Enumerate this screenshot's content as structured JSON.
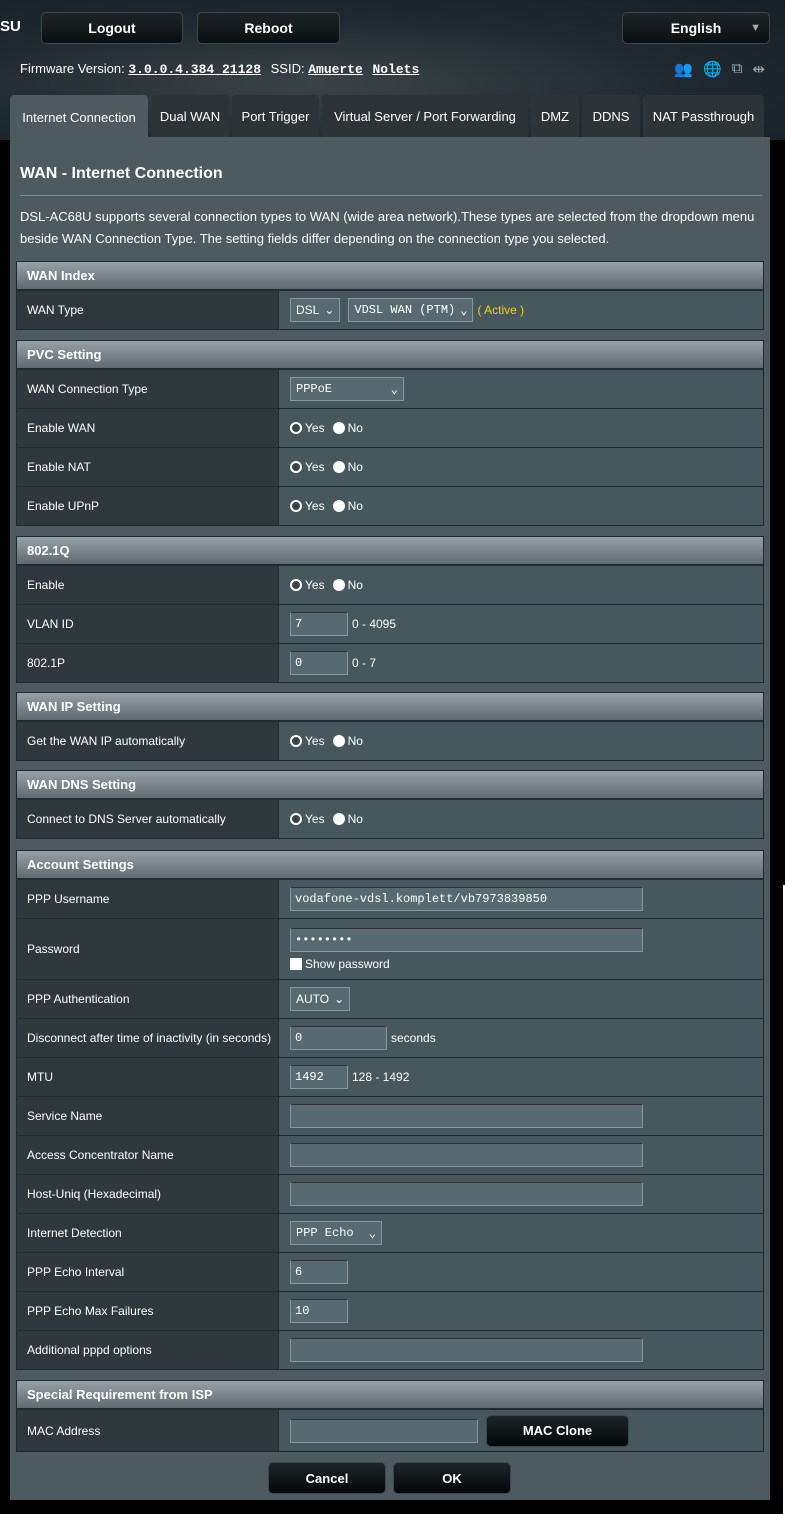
{
  "header": {
    "brand": "SU",
    "logout": "Logout",
    "reboot": "Reboot",
    "language": "English",
    "firmware_label": "Firmware Version:",
    "firmware": "3.0.0.4.384_21128",
    "ssid_label": "SSID:",
    "ssid1": "Amuerte",
    "ssid2": "Nolets"
  },
  "tabs": [
    "Internet Connection",
    "Dual WAN",
    "Port Trigger",
    "Virtual Server / Port Forwarding",
    "DMZ",
    "DDNS",
    "NAT Passthrough"
  ],
  "page": {
    "title": "WAN - Internet Connection",
    "description": "DSL-AC68U supports several connection types to WAN (wide area network).These types are selected from the dropdown menu beside WAN Connection Type. The setting fields differ depending on the connection type you selected."
  },
  "common": {
    "yes": "Yes",
    "no": "No"
  },
  "wan_index": {
    "title": "WAN Index",
    "wan_type_label": "WAN Type",
    "wan_type": "DSL",
    "wan_mode": "VDSL WAN (PTM)",
    "active": "( Active )"
  },
  "pvc": {
    "title": "PVC Setting",
    "conn_type_label": "WAN Connection Type",
    "conn_type": "PPPoE",
    "enable_wan": "Enable WAN",
    "enable_nat": "Enable NAT",
    "enable_upnp": "Enable UPnP"
  },
  "dot1q": {
    "title": "802.1Q",
    "enable": "Enable",
    "vlan_label": "VLAN ID",
    "vlan": "7",
    "vlan_range": "0 - 4095",
    "p_label": "802.1P",
    "p": "0",
    "p_range": "0 - 7"
  },
  "wanip": {
    "title": "WAN IP Setting",
    "auto": "Get the WAN IP automatically"
  },
  "wandns": {
    "title": "WAN DNS Setting",
    "auto": "Connect to DNS Server automatically"
  },
  "account": {
    "title": "Account Settings",
    "user_label": "PPP Username",
    "user": "vodafone-vdsl.komplett/vb7973839850",
    "pass_label": "Password",
    "pass": "••••••••",
    "show_pass": "Show password",
    "auth_label": "PPP Authentication",
    "auth": "AUTO",
    "idle_label": "Disconnect after time of inactivity (in seconds)",
    "idle": "0",
    "idle_unit": "seconds",
    "mtu_label": "MTU",
    "mtu": "1492",
    "mtu_range": "128 - 1492",
    "service_label": "Service Name",
    "ac_label": "Access Concentrator Name",
    "hostuniq_label": "Host-Uniq (Hexadecimal)",
    "detect_label": "Internet Detection",
    "detect": "PPP Echo",
    "echo_int_label": "PPP Echo Interval",
    "echo_int": "6",
    "echo_fail_label": "PPP Echo Max Failures",
    "echo_fail": "10",
    "pppd_label": "Additional pppd options"
  },
  "isp": {
    "title": "Special Requirement from ISP",
    "mac_label": "MAC Address",
    "mac_clone": "MAC Clone"
  },
  "footer": {
    "cancel": "Cancel",
    "ok": "OK"
  }
}
